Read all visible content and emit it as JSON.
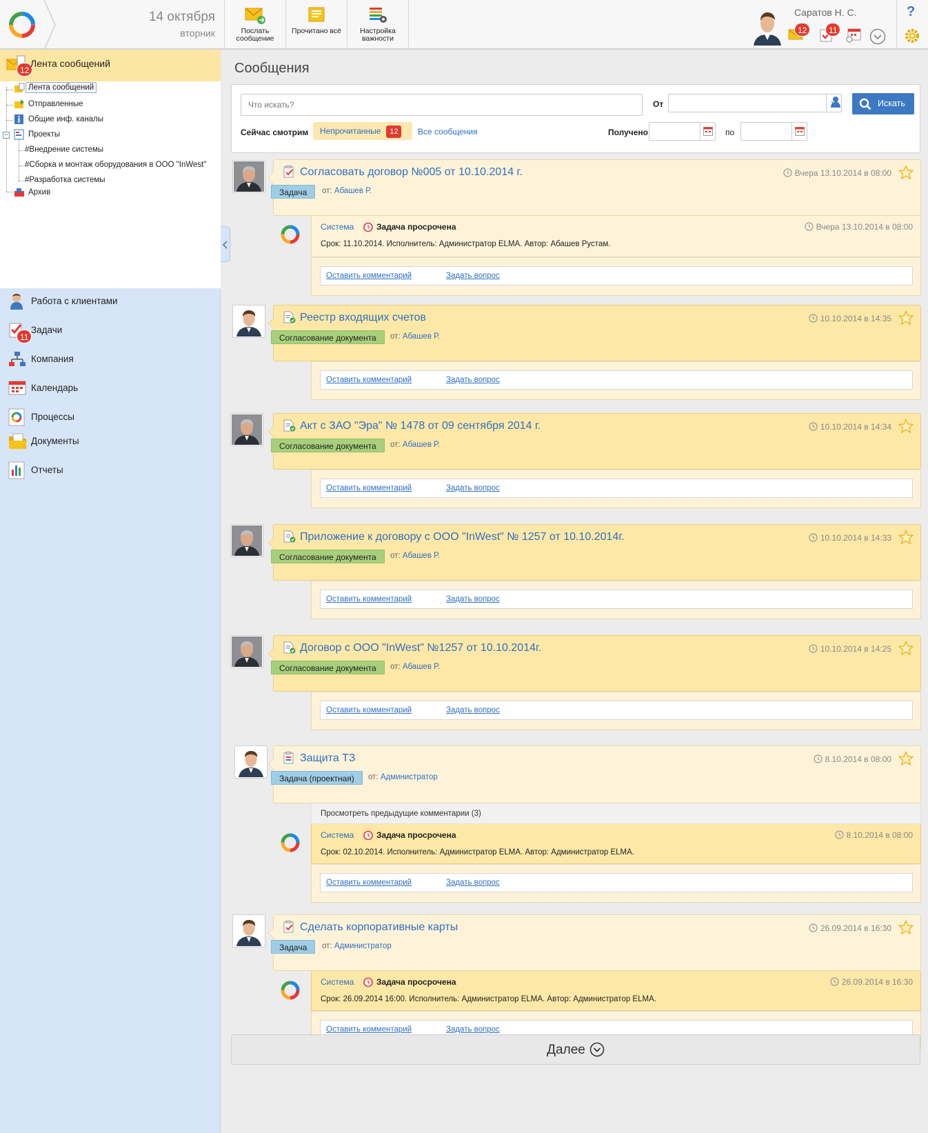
{
  "header": {
    "date": "14 октября",
    "weekday": "вторник",
    "toolbar": [
      {
        "label": "Послать сообщение",
        "icon": "send-message-icon"
      },
      {
        "label": "Прочитано всё",
        "icon": "mark-read-icon"
      },
      {
        "label": "Настройка важности",
        "icon": "importance-settings-icon"
      }
    ],
    "user_name": "Саратов Н. С.",
    "messages_badge": "12",
    "tasks_badge": "11",
    "help": "?"
  },
  "sidebar": {
    "feed_title": "Лента сообщений",
    "feed_badge": "12",
    "tree": [
      {
        "label": "Лента сообщений"
      },
      {
        "label": "Отправленные"
      },
      {
        "label": "Общие инф. каналы"
      },
      {
        "label": "Проекты"
      },
      {
        "label": "#Внедрение системы"
      },
      {
        "label": "#Сборка и монтаж оборудования в ООО \"InWest\""
      },
      {
        "label": "#Разработка системы"
      },
      {
        "label": "Архив"
      }
    ],
    "nav": [
      {
        "label": "Работа с клиентами",
        "icon": "clients-icon"
      },
      {
        "label": "Задачи",
        "icon": "tasks-icon",
        "badge": "11"
      },
      {
        "label": "Компания",
        "icon": "company-icon"
      },
      {
        "label": "Календарь",
        "icon": "calendar-icon"
      },
      {
        "label": "Процессы",
        "icon": "processes-icon"
      },
      {
        "label": "Документы",
        "icon": "documents-icon"
      },
      {
        "label": "Отчеты",
        "icon": "reports-icon"
      }
    ]
  },
  "main": {
    "title": "Сообщения",
    "search": {
      "placeholder": "Что искать?",
      "from_label": "От",
      "button": "Искать",
      "now_watching": "Сейчас смотрим",
      "unread_tab": "Непрочитанные",
      "unread_count": "12",
      "all_tab": "Все сообщения",
      "received_label": "Получено",
      "to_label": "по"
    },
    "messages": [
      {
        "title": "Согласовать договор №005 от 10.10.2014 г.",
        "time": "Вчера 13.10.2014 в 08:00",
        "tag": "Задача",
        "from_prefix": "от:",
        "from": "Абашев Р.",
        "sub": {
          "system": "Система",
          "status": "Задача просрочена",
          "time": "Вчера 13.10.2014 в 08:00",
          "text": "Срок: 11.10.2014. Исполнитель: Администратор ELMA. Автор: Абашев Рустам."
        }
      },
      {
        "title": "Реестр входящих счетов",
        "time": "10.10.2014 в 14:35",
        "tag": "Согласование документа",
        "from_prefix": "от:",
        "from": "Абашев Р."
      },
      {
        "title": "Акт с ЗАО \"Эра\" № 1478 от 09 сентября 2014 г.",
        "time": "10.10.2014 в 14:34",
        "tag": "Согласование документа",
        "from_prefix": "от:",
        "from": "Абашев Р."
      },
      {
        "title": "Приложение к договору с ООО \"InWest\" № 1257 от 10.10.2014г.",
        "time": "10.10.2014 в 14:33",
        "tag": "Согласование документа",
        "from_prefix": "от:",
        "from": "Абашев Р."
      },
      {
        "title": "Договор с ООО \"InWest\" №1257 от 10.10.2014г.",
        "time": "10.10.2014 в 14:25",
        "tag": "Согласование документа",
        "from_prefix": "от:",
        "from": "Абашев Р."
      },
      {
        "title": "Защита ТЗ",
        "time": "8.10.2014 в 08:00",
        "tag": "Задача (проектная)",
        "from_prefix": "от:",
        "from": "Администратор",
        "prev_comments": "Просмотреть предыдущие комментарии (3)",
        "sub": {
          "system": "Система",
          "status": "Задача просрочена",
          "time": "8.10.2014 в 08:00",
          "text": "Срок: 02.10.2014. Исполнитель: Администратор ELMA. Автор: Администратор ELMA."
        }
      },
      {
        "title": "Сделать корпоративные карты",
        "time": "26.09.2014 в 16:30",
        "tag": "Задача",
        "from_prefix": "от:",
        "from": "Администратор",
        "sub": {
          "system": "Система",
          "status": "Задача просрочена",
          "time": "26.09.2014 в 16:30",
          "text": "Срок: 26.09.2014 16:00. Исполнитель: Администратор ELMA. Автор: Администратор ELMA."
        }
      }
    ],
    "comment_link": "Оставить комментарий",
    "question_link": "Задать вопрос",
    "more": "Далее"
  }
}
